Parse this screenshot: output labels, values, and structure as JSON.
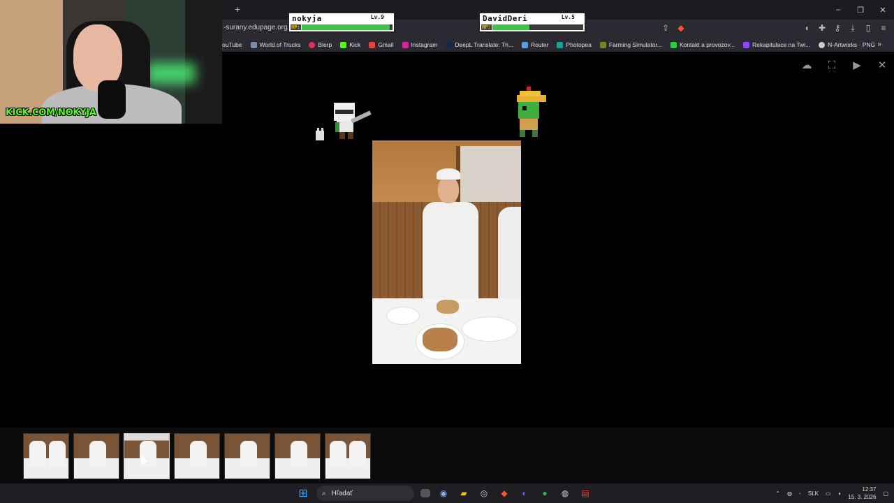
{
  "browser": {
    "new_tab": "+",
    "url": "-surany.edupage.org/a",
    "window_controls": [
      "–",
      "❐",
      "✕"
    ],
    "bookmarks": [
      {
        "label": "ouTube",
        "icon": "youtube-icon",
        "color": "#ff0000"
      },
      {
        "label": "World of Trucks",
        "icon": "truck-icon",
        "color": "#7a8aa0"
      },
      {
        "label": "Blerp",
        "icon": "blerp-icon",
        "color": "#e0305a"
      },
      {
        "label": "Kick",
        "icon": "kick-icon",
        "color": "#53fc18"
      },
      {
        "label": "Gmail",
        "icon": "gmail-icon",
        "color": "#ea4335"
      },
      {
        "label": "Instagram",
        "icon": "instagram-icon",
        "color": "#d6249f"
      },
      {
        "label": "DeepL Translate: Th...",
        "icon": "deepl-icon",
        "color": "#0f2b46"
      },
      {
        "label": "Router",
        "icon": "router-icon",
        "color": "#5aa0e0"
      },
      {
        "label": "Photopea",
        "icon": "photopea-icon",
        "color": "#18a497"
      },
      {
        "label": "Farming Simulator...",
        "icon": "farming-icon",
        "color": "#6b8e23"
      },
      {
        "label": "Kontakt a provozov...",
        "icon": "kontakt-icon",
        "color": "#2ecc40"
      },
      {
        "label": "Rekapitulace na Twi...",
        "icon": "twitch-icon",
        "color": "#9146ff"
      },
      {
        "label": "N-Artworks · PNG",
        "icon": "globe-icon",
        "color": "#cccccc"
      }
    ],
    "bookmarks_more": "»"
  },
  "game": {
    "player1": {
      "name": "nokyja",
      "level": "Lv.9",
      "hp_label": "HP:",
      "hp_fraction": 0.97
    },
    "player2": {
      "name": "DavidDeri",
      "level": "Lv.5",
      "hp_label": "HP:",
      "hp_fraction": 0.41
    }
  },
  "webcam": {
    "overlay_text": "KICK.COM/NOKYJA"
  },
  "taskbar": {
    "search_placeholder": "Hľadať",
    "language": "SLK",
    "time": "12:37",
    "date": "15. 3. 2026"
  },
  "colors": {
    "hp_green": "#3fc14a",
    "kick_green": "#53fc18",
    "brave_orange": "#fb542b"
  }
}
